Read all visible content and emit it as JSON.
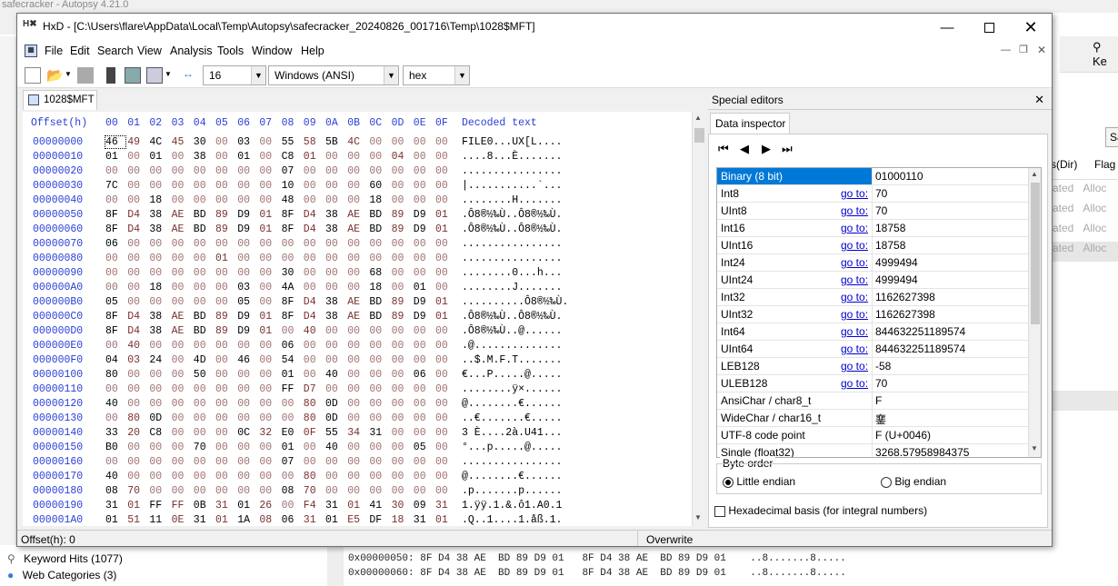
{
  "background": {
    "app_title": "safecracker - Autopsy 4.21.0",
    "tree_items": [
      {
        "label": "Keyword Hits (1077)"
      },
      {
        "label": "Web Categories (3)"
      }
    ],
    "right_columns": [
      "s(Dir)",
      "Flag"
    ],
    "right_cells": [
      [
        "ated",
        "Alloc"
      ],
      [
        "ated",
        "Alloc"
      ],
      [
        "ated",
        "Alloc"
      ],
      [
        "ated",
        "Alloc"
      ]
    ],
    "right_button": "Sa",
    "keyword_fragment": "Ke",
    "hex_lines": [
      "0x00000050: 8F D4 38 AE  BD 89 D9 01   8F D4 38 AE  BD 89 D9 01    ..8.......8.....",
      "0x00000060: 8F D4 38 AE  BD 89 D9 01   8F D4 38 AE  BD 89 D9 01    ..8.......8....."
    ]
  },
  "window": {
    "title": "HxD - [C:\\Users\\flare\\AppData\\Local\\Temp\\Autopsy\\safecracker_20240826_001716\\Temp\\1028$MFT]",
    "menu": [
      "File",
      "Edit",
      "Search",
      "View",
      "Analysis",
      "Tools",
      "Window",
      "Help"
    ],
    "toolbar": {
      "bytes_per_row": "16",
      "charset": "Windows (ANSI)",
      "base": "hex"
    },
    "tab": "1028$MFT"
  },
  "hex": {
    "header_offset": "Offset(h)",
    "header_cols": [
      "00",
      "01",
      "02",
      "03",
      "04",
      "05",
      "06",
      "07",
      "08",
      "09",
      "0A",
      "0B",
      "0C",
      "0D",
      "0E",
      "0F"
    ],
    "header_decoded": "Decoded text",
    "rows": [
      {
        "o": "00000000",
        "h": "46 49 4C 45 30 00 03 00 55 58 5B 4C 00 00 00 00",
        "a": "FILE0...UX[L...."
      },
      {
        "o": "00000010",
        "h": "01 00 01 00 38 00 01 00 C8 01 00 00 00 04 00 00",
        "a": "....8...È......."
      },
      {
        "o": "00000020",
        "h": "00 00 00 00 00 00 00 00 07 00 00 00 00 00 00 00",
        "a": "................"
      },
      {
        "o": "00000030",
        "h": "7C 00 00 00 00 00 00 00 10 00 00 00 60 00 00 00",
        "a": "|...........`..."
      },
      {
        "o": "00000040",
        "h": "00 00 18 00 00 00 00 00 48 00 00 00 18 00 00 00",
        "a": "........H......."
      },
      {
        "o": "00000050",
        "h": "8F D4 38 AE BD 89 D9 01 8F D4 38 AE BD 89 D9 01",
        "a": ".Ô8®½‰Ù..Ô8®½‰Ù."
      },
      {
        "o": "00000060",
        "h": "8F D4 38 AE BD 89 D9 01 8F D4 38 AE BD 89 D9 01",
        "a": ".Ô8®½‰Ù..Ô8®½‰Ù."
      },
      {
        "o": "00000070",
        "h": "06 00 00 00 00 00 00 00 00 00 00 00 00 00 00 00",
        "a": "................"
      },
      {
        "o": "00000080",
        "h": "00 00 00 00 00 01 00 00 00 00 00 00 00 00 00 00",
        "a": "................"
      },
      {
        "o": "00000090",
        "h": "00 00 00 00 00 00 00 00 30 00 00 00 68 00 00 00",
        "a": "........0...h..."
      },
      {
        "o": "000000A0",
        "h": "00 00 18 00 00 00 03 00 4A 00 00 00 18 00 01 00",
        "a": "........J......."
      },
      {
        "o": "000000B0",
        "h": "05 00 00 00 00 00 05 00 8F D4 38 AE BD 89 D9 01",
        "a": "..........Ô8®½‰Ù."
      },
      {
        "o": "000000C0",
        "h": "8F D4 38 AE BD 89 D9 01 8F D4 38 AE BD 89 D9 01",
        "a": ".Ô8®½‰Ù..Ô8®½‰Ù."
      },
      {
        "o": "000000D0",
        "h": "8F D4 38 AE BD 89 D9 01 00 40 00 00 00 00 00 00",
        "a": ".Ô8®½‰Ù..@......"
      },
      {
        "o": "000000E0",
        "h": "00 40 00 00 00 00 00 00 06 00 00 00 00 00 00 00",
        "a": ".@.............."
      },
      {
        "o": "000000F0",
        "h": "04 03 24 00 4D 00 46 00 54 00 00 00 00 00 00 00",
        "a": "..$.M.F.T......."
      },
      {
        "o": "00000100",
        "h": "80 00 00 00 50 00 00 00 01 00 40 00 00 00 06 00",
        "a": "€...P.....@....."
      },
      {
        "o": "00000110",
        "h": "00 00 00 00 00 00 00 00 FF D7 00 00 00 00 00 00",
        "a": "........ÿ×......"
      },
      {
        "o": "00000120",
        "h": "40 00 00 00 00 00 00 00 00 80 0D 00 00 00 00 00",
        "a": "@........€......"
      },
      {
        "o": "00000130",
        "h": "00 80 0D 00 00 00 00 00 00 80 0D 00 00 00 00 00",
        "a": "..€.......€....."
      },
      {
        "o": "00000140",
        "h": "33 20 C8 00 00 00 0C 32 E0 0F 55 34 31 00 00 00",
        "a": "3 È....2à.U41..."
      },
      {
        "o": "00000150",
        "h": "B0 00 00 00 70 00 00 00 01 00 40 00 00 00 05 00",
        "a": "°...p.....@....."
      },
      {
        "o": "00000160",
        "h": "00 00 00 00 00 00 00 00 07 00 00 00 00 00 00 00",
        "a": "................"
      },
      {
        "o": "00000170",
        "h": "40 00 00 00 00 00 00 00 00 80 00 00 00 00 00 00",
        "a": "@........€......"
      },
      {
        "o": "00000180",
        "h": "08 70 00 00 00 00 00 00 08 70 00 00 00 00 00 00",
        "a": ".p.......p......"
      },
      {
        "o": "00000190",
        "h": "31 01 FF FF 0B 31 01 26 00 F4 31 01 41 30 09 31",
        "a": "1.ÿÿ.1.&.ô1.A0.1"
      },
      {
        "o": "000001A0",
        "h": "01 51 11 0E 31 01 1A 08 06 31 01 E5 DF 18 31 01",
        "a": ".Q..1....1.åß.1."
      }
    ]
  },
  "status": {
    "offset": "Offset(h): 0",
    "mode": "Overwrite"
  },
  "special_editors": {
    "title": "Special editors",
    "tab": "Data inspector",
    "goto_label": "go to:",
    "rows": [
      {
        "name": "Binary (8 bit)",
        "value": "01000110",
        "goto": false
      },
      {
        "name": "Int8",
        "value": "70",
        "goto": true
      },
      {
        "name": "UInt8",
        "value": "70",
        "goto": true
      },
      {
        "name": "Int16",
        "value": "18758",
        "goto": true
      },
      {
        "name": "UInt16",
        "value": "18758",
        "goto": true
      },
      {
        "name": "Int24",
        "value": "4999494",
        "goto": true
      },
      {
        "name": "UInt24",
        "value": "4999494",
        "goto": true
      },
      {
        "name": "Int32",
        "value": "1162627398",
        "goto": true
      },
      {
        "name": "UInt32",
        "value": "1162627398",
        "goto": true
      },
      {
        "name": "Int64",
        "value": "844632251189574",
        "goto": true
      },
      {
        "name": "UInt64",
        "value": "844632251189574",
        "goto": true
      },
      {
        "name": "LEB128",
        "value": "-58",
        "goto": true
      },
      {
        "name": "ULEB128",
        "value": "70",
        "goto": true
      },
      {
        "name": "AnsiChar / char8_t",
        "value": "F",
        "goto": false
      },
      {
        "name": "WideChar / char16_t",
        "value": "䥆",
        "goto": false
      },
      {
        "name": "UTF-8 code point",
        "value": "F (U+0046)",
        "goto": false
      },
      {
        "name": "Single (float32)",
        "value": "3268.57958984375",
        "goto": false
      }
    ],
    "byte_order_label": "Byte order",
    "little_endian": "Little endian",
    "big_endian": "Big endian",
    "hex_basis": "Hexadecimal basis (for integral numbers)"
  }
}
